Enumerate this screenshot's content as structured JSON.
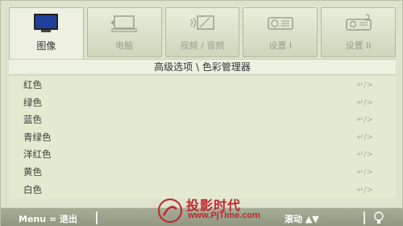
{
  "tabs": [
    {
      "label": "图像",
      "icon": "monitor-icon",
      "active": true
    },
    {
      "label": "电脑",
      "icon": "computer-icon",
      "active": false
    },
    {
      "label": "视频 / 音频",
      "icon": "video-audio-icon",
      "active": false
    },
    {
      "label": "设置 I",
      "icon": "settings-projector-icon",
      "active": false
    },
    {
      "label": "设置 II",
      "icon": "settings-projector-2-icon",
      "active": false
    }
  ],
  "subtitle": "高级选项 \\ 色彩管理器",
  "menu": {
    "items": [
      {
        "label": "红色",
        "action": "↵/>"
      },
      {
        "label": "绿色",
        "action": "↵/>"
      },
      {
        "label": "蓝色",
        "action": "↵/>"
      },
      {
        "label": "青绿色",
        "action": "↵/>"
      },
      {
        "label": "洋红色",
        "action": "↵/>"
      },
      {
        "label": "黄色",
        "action": "↵/>"
      },
      {
        "label": "白色",
        "action": "↵/>"
      }
    ]
  },
  "footer": {
    "exit": "Menu = 退出",
    "scroll": "滚动 ▲▼",
    "hint_icon": "lightbulb-icon"
  },
  "watermark": {
    "brand": "投影时代",
    "url": "www.PjTime.com"
  },
  "colors": {
    "background": "#dde3cc",
    "footer": "#9aa08a",
    "watermark": "#c0262e",
    "active_icon": "#1f3f9a"
  }
}
